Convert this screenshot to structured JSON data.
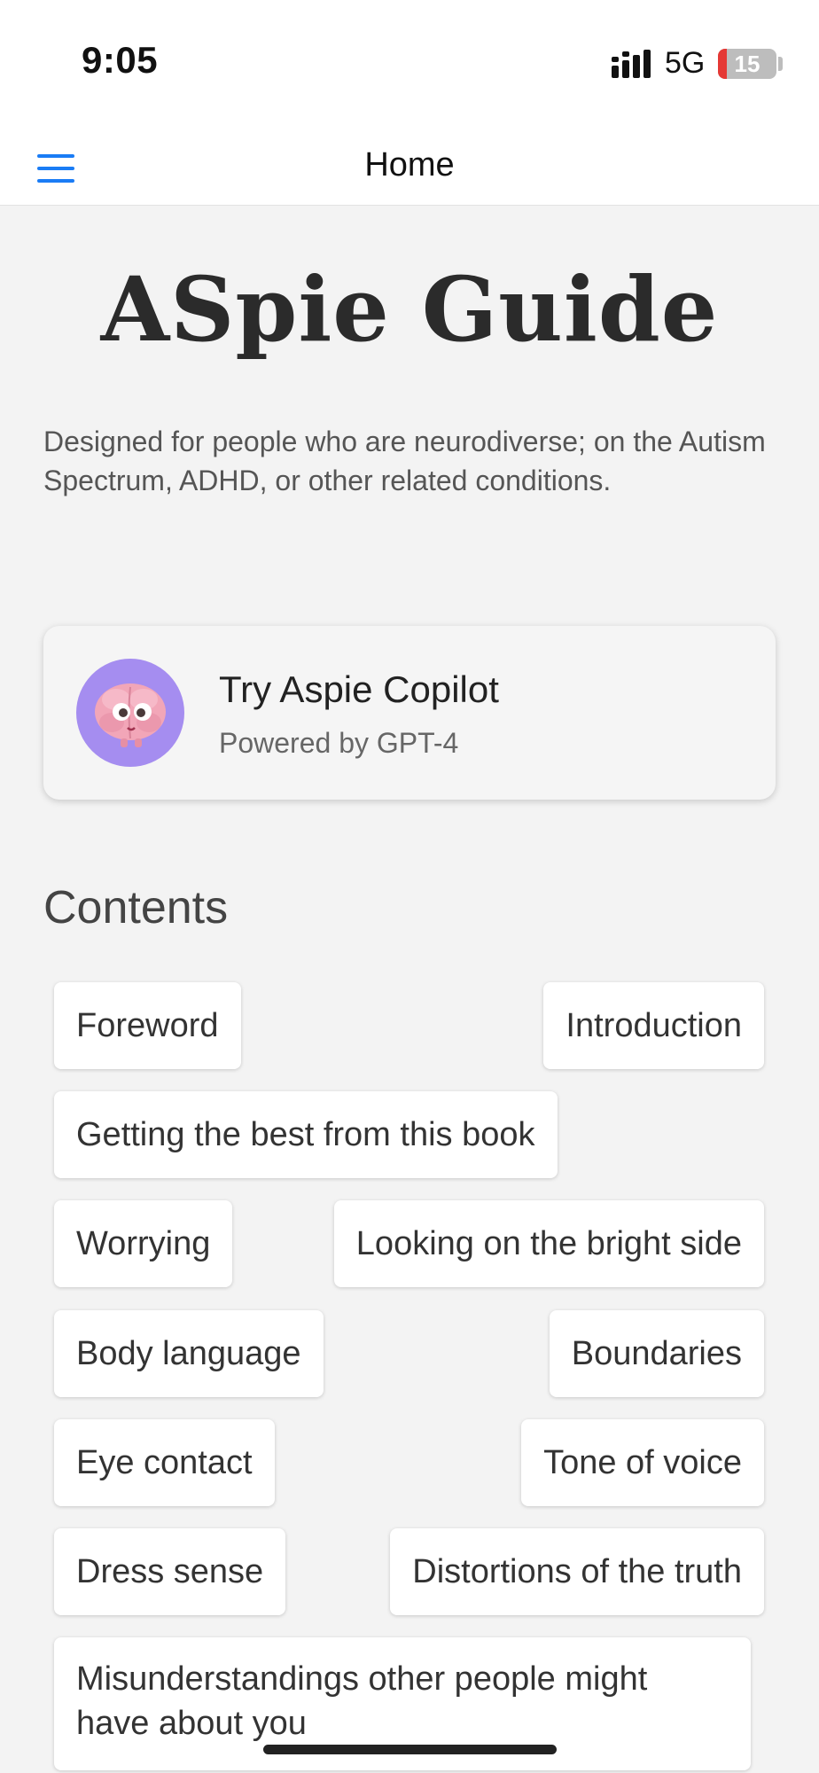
{
  "status_bar": {
    "time": "9:05",
    "network": "5G",
    "battery": "15",
    "battery_level": 0.15
  },
  "nav": {
    "title": "Home",
    "menu_icon": "hamburger-menu-icon"
  },
  "hero": {
    "title": "ASpie Guide",
    "description": "Designed for people who are neurodiverse; on the Autism Spectrum, ADHD, or other related conditions."
  },
  "copilot": {
    "title": "Try Aspie Copilot",
    "subtitle": "Powered by GPT-4",
    "icon": "brain-avatar-icon"
  },
  "contents": {
    "heading": "Contents",
    "items": [
      "Foreword",
      "Introduction",
      "Getting the best from this book",
      "Worrying",
      "Looking on the bright side",
      "Body language",
      "Boundaries",
      "Eye contact",
      "Tone of voice",
      "Dress sense",
      "Distortions of the truth",
      "Misunderstandings other people might have about you"
    ]
  },
  "colors": {
    "accent": "#1a7cf5",
    "background": "#f3f3f3",
    "avatar_bg": "#a58df0"
  }
}
